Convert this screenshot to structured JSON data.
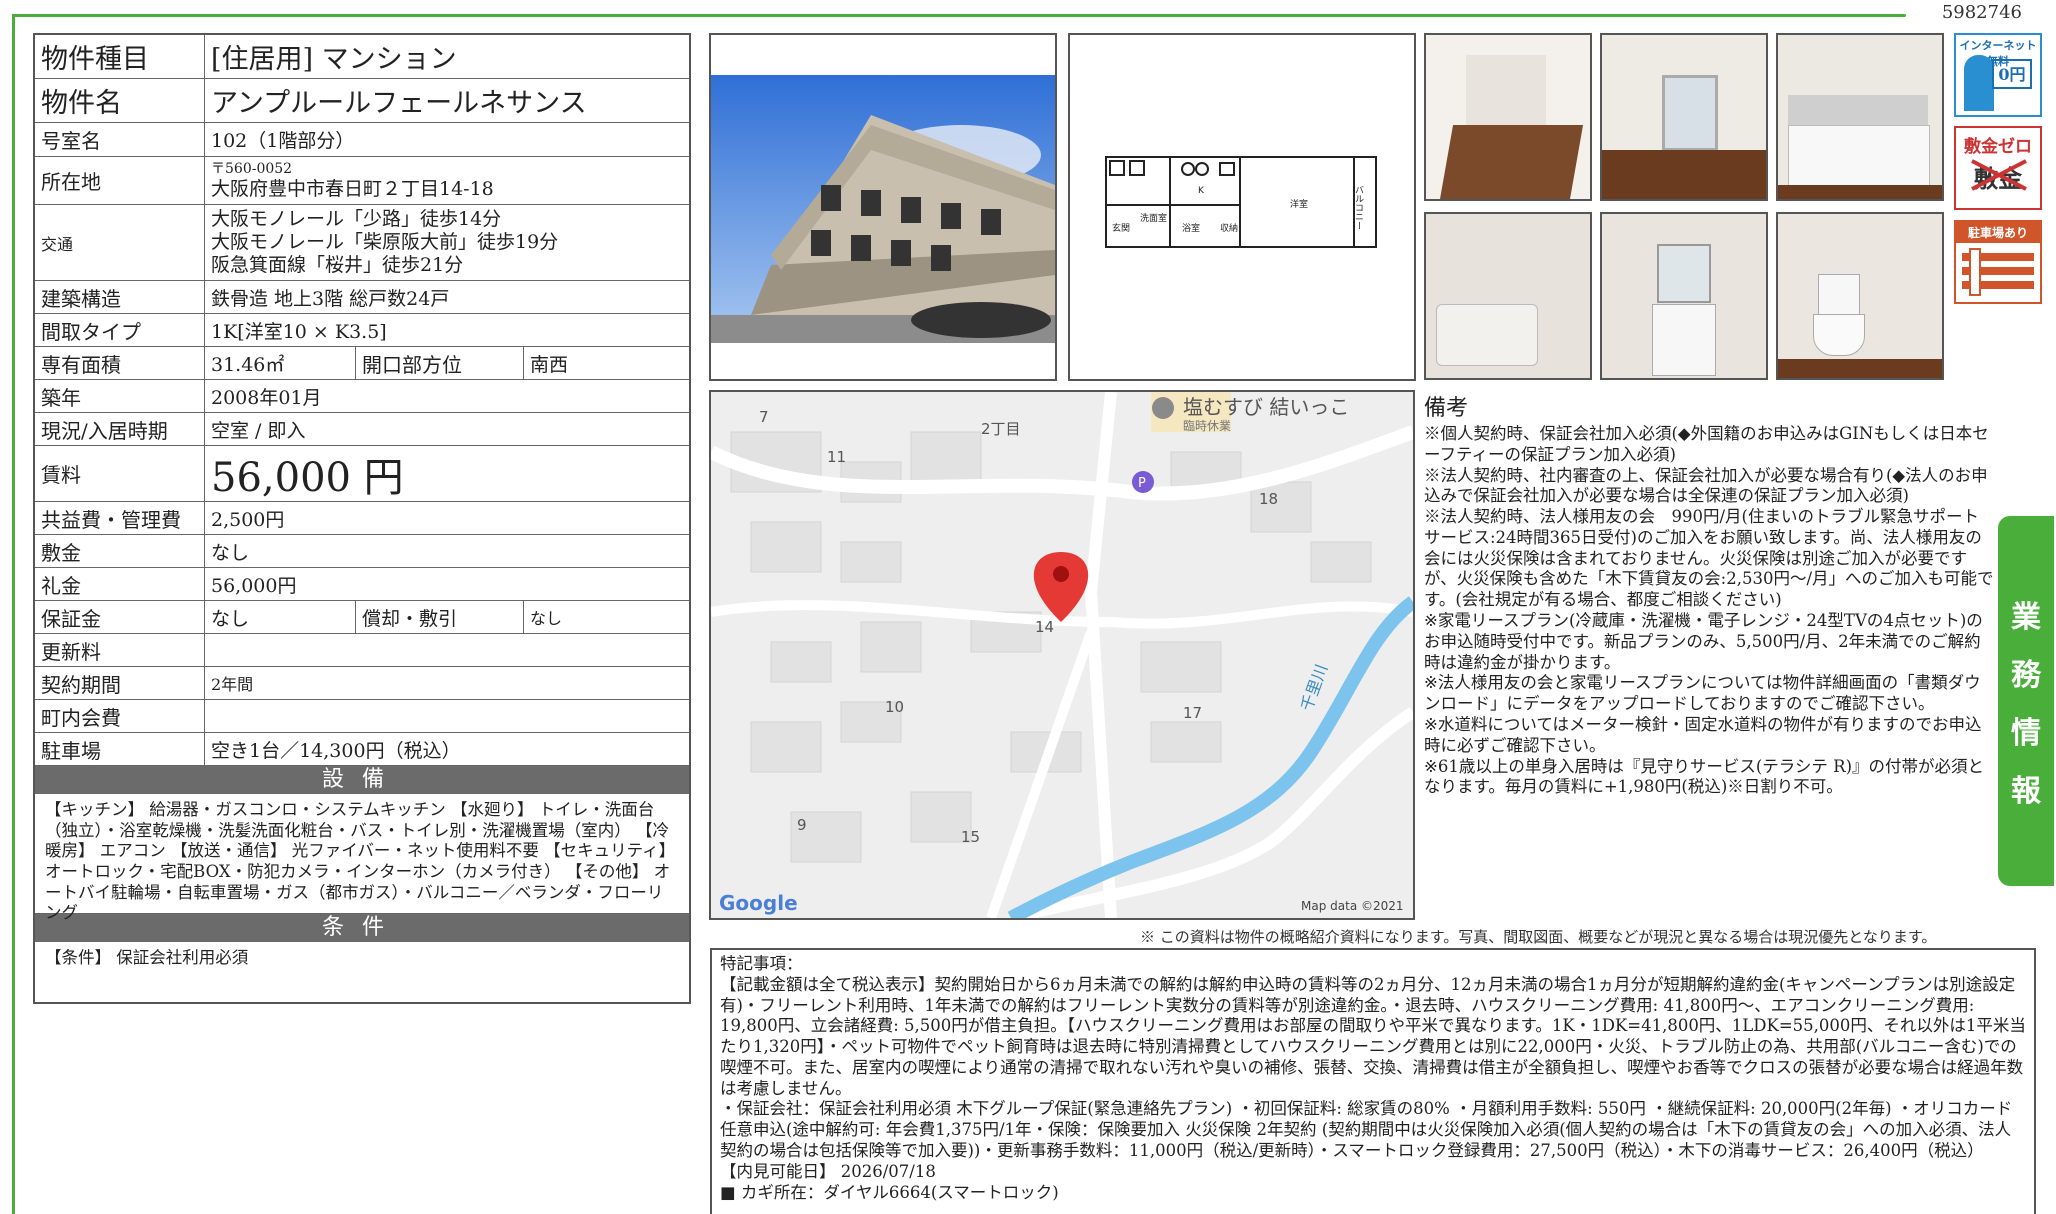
{
  "doc_id": "5982746",
  "table": {
    "type_label": "物件種目",
    "type_value": "[住居用] マンション",
    "name_label": "物件名",
    "name_value": "アンプルールフェールネサンス",
    "room_label": "号室名",
    "room_value": "102（1階部分）",
    "address_label": "所在地",
    "zip": "〒560-0052",
    "address": "大阪府豊中市春日町２丁目14-18",
    "access_label": "交通",
    "access": [
      "大阪モノレール「少路」徒歩14分",
      "大阪モノレール「柴原阪大前」徒歩19分",
      "阪急箕面線「桜井」徒歩21分"
    ],
    "structure_label": "建築構造",
    "structure_value": "鉄骨造 地上3階 総戸数24戸",
    "layout_label": "間取タイプ",
    "layout_value": "1K[洋室10 × K3.5]",
    "area_label": "専有面積",
    "area_value": "31.46㎡",
    "direction_label": "開口部方位",
    "direction_value": "南西",
    "built_label": "築年",
    "built_value": "2008年01月",
    "status_label": "現況/入居時期",
    "status_value": "空室 / 即入",
    "rent_label": "賃料",
    "rent_value": "56,000 円",
    "fee_label": "共益費・管理費",
    "fee_value": "2,500円",
    "deposit_label": "敷金",
    "deposit_value": "なし",
    "key_label": "礼金",
    "key_value": "56,000円",
    "guarantee_label": "保証金",
    "guarantee_value": "なし",
    "amort_label": "償却・敷引",
    "amort_value": "なし",
    "renewal_label": "更新料",
    "renewal_value": "",
    "term_label": "契約期間",
    "term_value": "2年間",
    "town_label": "町内会費",
    "town_value": "",
    "parking_label": "駐車場",
    "parking_value": "空き1台／14,300円（税込）"
  },
  "facilities": {
    "title": "設備",
    "text": "【キッチン】 給湯器・ガスコンロ・システムキッチン 【水廻り】 トイレ・洗面台（独立）・浴室乾燥機・洗髪洗面化粧台・バス・トイレ別・洗濯機置場（室内） 【冷暖房】 エアコン 【放送・通信】 光ファイバー・ネット使用料不要 【セキュリティ】 オートロック・宅配BOX・防犯カメラ・インターホン（カメラ付き） 【その他】 オートバイ駐輪場・自転車置場・ガス（都市ガス）・バルコニー／ベランダ・フローリング"
  },
  "conditions": {
    "title": "条件",
    "text": "【条件】 保証会社利用必須"
  },
  "floorplan": {
    "labels": [
      "玄関",
      "K",
      "洋室",
      "バルコニー",
      "洗面室",
      "浴室",
      "収納"
    ]
  },
  "map": {
    "poi": "塩むすび 結いっこ",
    "poi_sub": "臨時休業",
    "area": "2丁目",
    "river": "千里川",
    "numbers": [
      "7",
      "11",
      "18",
      "14",
      "10",
      "17",
      "9",
      "15"
    ],
    "brand": "Google",
    "credit": "Map data ©2021"
  },
  "badges": {
    "internet": "インターネット無料",
    "internet_price": "0円",
    "deposit_zero": "敷金ゼロ",
    "deposit_word": "敷金",
    "parking": "駐車場あり"
  },
  "side_tab": [
    "業",
    "務",
    "情",
    "報"
  ],
  "remarks": {
    "title": "備考",
    "text": "※個人契約時、保証会社加入必須(◆外国籍のお申込みはGINもしくは日本セーフティーの保証プラン加入必須)\n※法人契約時、社内審査の上、保証会社加入が必要な場合有り(◆法人のお申込みで保証会社加入が必要な場合は全保連の保証プラン加入必須)\n※法人契約時、法人様用友の会　990円/月(住まいのトラブル緊急サポートサービス:24時間365日受付)のご加入をお願い致します。尚、法人様用友の会には火災保険は含まれておりません。火災保険は別途ご加入が必要ですが、火災保険も含めた「木下賃貸友の会:2,530円～/月」へのご加入も可能です。(会社規定が有る場合、都度ご相談ください)\n※家電リースプラン(冷蔵庫・洗濯機・電子レンジ・24型TVの4点セット)のお申込随時受付中です。新品プランのみ、5,500円/月、2年未満でのご解約時は違約金が掛かります。\n※法人様用友の会と家電リースプランについては物件詳細画面の「書類ダウンロード」にデータをアップロードしておりますのでご確認下さい。\n※水道料についてはメーター検針・固定水道料の物件が有りますのでお申込時に必ずご確認下さい。\n※61歳以上の単身入居時は『見守りサービス(テラシテ R)』の付帯が必須となります。毎月の賃料に+1,980円(税込)※日割り不可。"
  },
  "notice": "※ この資料は物件の概略紹介資料になります。写真、間取図面、概要などが現況と異なる場合は現況優先となります。",
  "special": {
    "title": "特記事項：",
    "text": "【記載金額は全て税込表示】契約開始日から6ヵ月未満での解約は解約申込時の賃料等の2ヵ月分、12ヵ月未満の場合1ヵ月分が短期解約違約金(キャンペーンプランは別途設定有)・フリーレント利用時、1年未満での解約はフリーレント実数分の賃料等が別途違約金。・退去時、ハウスクリーニング費用: 41,800円～、エアコンクリーニング費用: 19,800円、立会諸経費: 5,500円が借主負担。【ハウスクリーニング費用はお部屋の間取りや平米で異なります。1K・1DK=41,800円、1LDK=55,000円、それ以外は1平米当たり1,320円】・ペット可物件でペット飼育時は退去時に特別清掃費としてハウスクリーニング費用とは別に22,000円・火災、トラブル防止の為、共用部(バルコニー含む)での喫煙不可。また、居室内の喫煙により通常の清掃で取れない汚れや臭いの補修、張替、交換、清掃費は借主が全額負担し、喫煙やお香等でクロスの張替が必要な場合は経過年数は考慮しません。\n・保証会社：保証会社利用必須 木下グループ保証(緊急連絡先プラン) ・初回保証料: 総家賃の80% ・月額利用手数料: 550円 ・継続保証料: 20,000円(2年毎) ・オリコカード任意申込(途中解約可: 年会費1,375円/1年・保険：保険要加入 火災保険 2年契約 (契約期間中は火災保険加入必須(個人契約の場合は「木下の賃貸友の会」への加入必須、法人契約の場合は包括保険等で加入要))・更新事務手数料：11,000円（税込/更新時）・スマートロック登録費用：27,500円（税込）・木下の消毒サービス：26,400円（税込）\n【内見可能日】 2026/07/18\n■ カギ所在：ダイヤル6664(スマートロック)"
  }
}
